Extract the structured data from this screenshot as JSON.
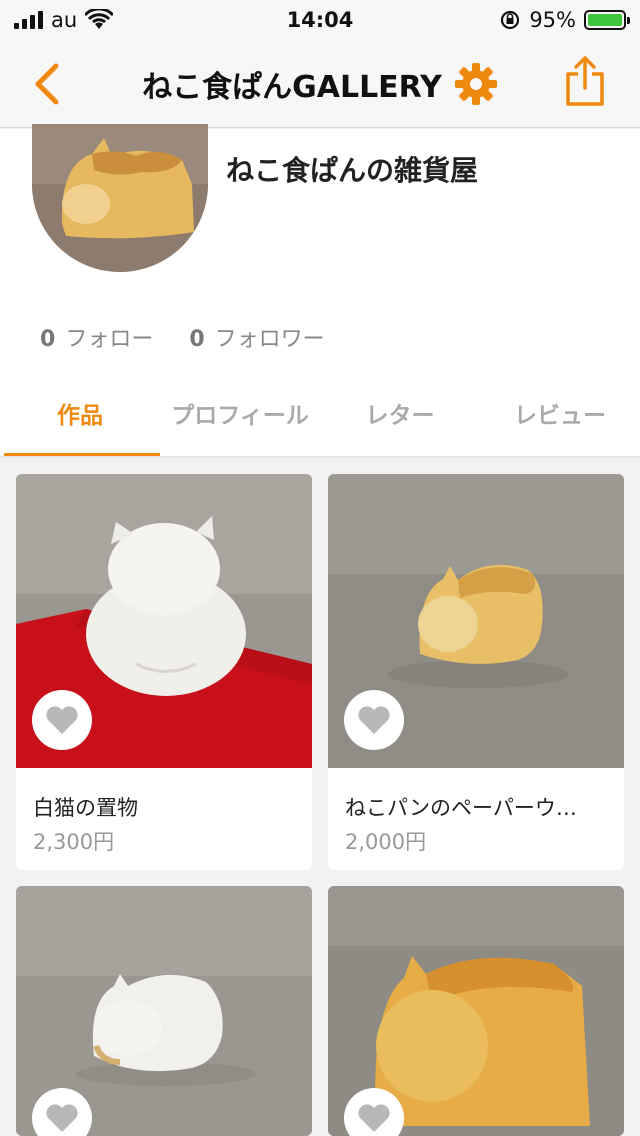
{
  "status_bar": {
    "carrier": "au",
    "time": "14:04",
    "battery_percent": "95%",
    "battery_color": "#3ec53e"
  },
  "nav": {
    "title": "ねこ食ぱんGALLERY",
    "back_icon": "chevron-left-icon",
    "settings_icon": "gear-icon",
    "share_icon": "share-icon",
    "accent_color": "#f0890f"
  },
  "profile": {
    "shop_name": "ねこ食ぱんの雑貨屋",
    "follow_count": "0",
    "follow_label": "フォロー",
    "follower_count": "0",
    "follower_label": "フォロワー"
  },
  "tabs": [
    {
      "label": "作品",
      "active": true
    },
    {
      "label": "プロフィール",
      "active": false
    },
    {
      "label": "レター",
      "active": false
    },
    {
      "label": "レビュー",
      "active": false
    }
  ],
  "items": [
    {
      "title": "白猫の置物",
      "price": "2,300円"
    },
    {
      "title": "ねこパンのペーパーウ…",
      "price": "2,000円"
    },
    {
      "title": "",
      "price": ""
    },
    {
      "title": "",
      "price": ""
    }
  ]
}
